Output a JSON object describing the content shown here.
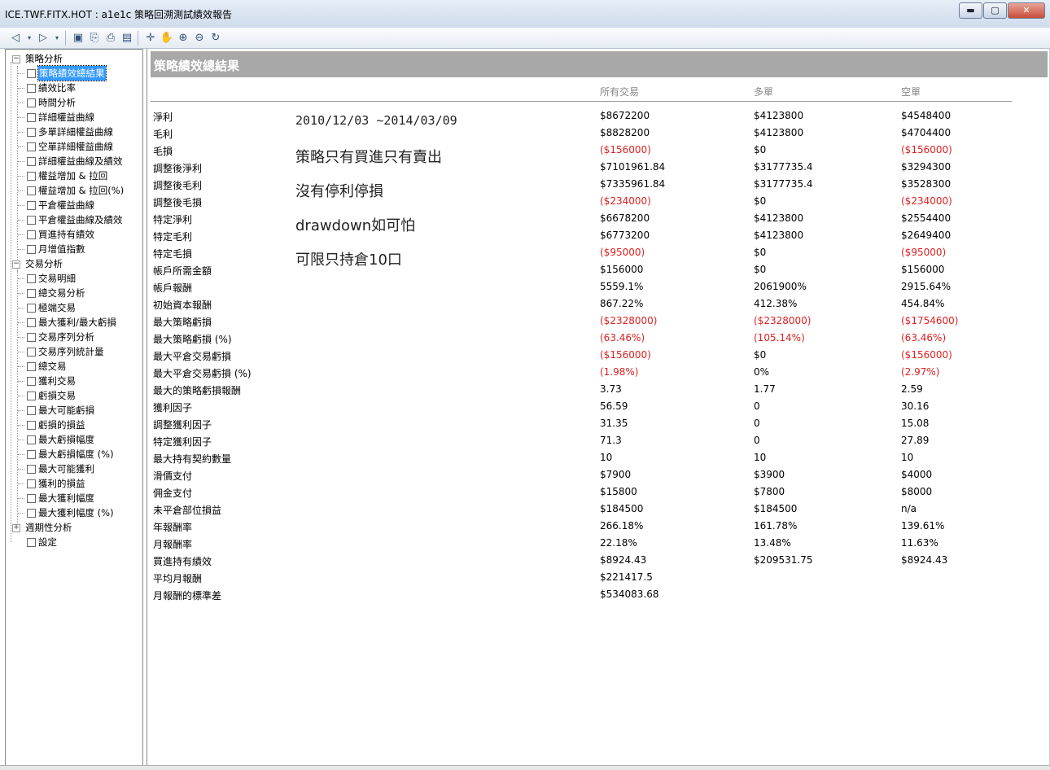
{
  "window": {
    "title": "ICE.TWF.FITX.HOT : a1e1c 策略回溯測試績效報告",
    "minimize": "▬",
    "maximize": "▢",
    "close": "✕"
  },
  "toolbar": {
    "back": "◁",
    "dropdown": "▾",
    "forward": "▷",
    "save": "▣",
    "export": "⎘",
    "print": "⎙",
    "view": "▤",
    "crosshair": "✛",
    "hand": "✋",
    "zoom_in": "⊕",
    "zoom_out": "⊖",
    "refresh": "↻"
  },
  "tree": {
    "strategy_analysis": "策略分析",
    "strategy_items": [
      "策略績效總結果",
      "績效比率",
      "時間分析",
      "詳細權益曲線",
      "多單詳細權益曲線",
      "空單詳細權益曲線",
      "詳細權益曲線及績效",
      "權益增加 & 拉回",
      "權益增加 & 拉回(%)",
      "平倉權益曲線",
      "平倉權益曲線及績效",
      "買進持有績效",
      "月增值指數"
    ],
    "trade_analysis": "交易分析",
    "trade_items": [
      "交易明細",
      "總交易分析",
      "極端交易",
      "最大獲利/最大虧損",
      "交易序列分析",
      "交易序列統計量",
      "總交易",
      "獲利交易",
      "虧損交易",
      "最大可能虧損",
      "虧損的損益",
      "最大虧損幅度",
      "最大虧損幅度 (%)",
      "最大可能獲利",
      "獲利的損益",
      "最大獲利幅度",
      "最大獲利幅度 (%)"
    ],
    "periodic_analysis": "週期性分析",
    "settings": "設定"
  },
  "report": {
    "title": "策略績效總結果",
    "columns": [
      "所有交易",
      "多單",
      "空單"
    ],
    "notes": [
      "2010/12/03 ~2014/03/09",
      "策略只有買進只有賣出",
      "沒有停利停損",
      "drawdown如可怕",
      "可限只持倉10口"
    ],
    "rows": [
      {
        "label": "淨利",
        "all": "$8672200",
        "long": "$4123800",
        "short": "$4548400"
      },
      {
        "label": "毛利",
        "all": "$8828200",
        "long": "$4123800",
        "short": "$4704400"
      },
      {
        "label": "毛損",
        "all": "($156000)",
        "long": "$0",
        "short": "($156000)"
      },
      {
        "label": "調整後淨利",
        "all": "$7101961.84",
        "long": "$3177735.4",
        "short": "$3294300"
      },
      {
        "label": "調整後毛利",
        "all": "$7335961.84",
        "long": "$3177735.4",
        "short": "$3528300"
      },
      {
        "label": "調整後毛損",
        "all": "($234000)",
        "long": "$0",
        "short": "($234000)"
      },
      {
        "label": "特定淨利",
        "all": "$6678200",
        "long": "$4123800",
        "short": "$2554400"
      },
      {
        "label": "特定毛利",
        "all": "$6773200",
        "long": "$4123800",
        "short": "$2649400"
      },
      {
        "label": "特定毛損",
        "all": "($95000)",
        "long": "$0",
        "short": "($95000)"
      },
      {
        "label": "帳戶所需金額",
        "all": "$156000",
        "long": "$0",
        "short": "$156000"
      },
      {
        "label": "帳戶報酬",
        "all": "5559.1%",
        "long": "2061900%",
        "short": "2915.64%"
      },
      {
        "label": "初始資本報酬",
        "all": "867.22%",
        "long": "412.38%",
        "short": "454.84%"
      },
      {
        "label": "最大策略虧損",
        "all": "($2328000)",
        "long": "($2328000)",
        "short": "($1754600)"
      },
      {
        "label": "最大策略虧損 (%)",
        "all": "(63.46%)",
        "long": "(105.14%)",
        "short": "(63.46%)"
      },
      {
        "label": "最大平倉交易虧損",
        "all": "($156000)",
        "long": "$0",
        "short": "($156000)"
      },
      {
        "label": "最大平倉交易虧損 (%)",
        "all": "(1.98%)",
        "long": "0%",
        "short": "(2.97%)"
      },
      {
        "label": "最大的策略虧損報酬",
        "all": "3.73",
        "long": "1.77",
        "short": "2.59"
      },
      {
        "label": "獲利因子",
        "all": "56.59",
        "long": "0",
        "short": "30.16"
      },
      {
        "label": "調整獲利因子",
        "all": "31.35",
        "long": "0",
        "short": "15.08"
      },
      {
        "label": "特定獲利因子",
        "all": "71.3",
        "long": "0",
        "short": "27.89"
      },
      {
        "label": "最大持有契約數量",
        "all": "10",
        "long": "10",
        "short": "10"
      },
      {
        "label": "滑價支付",
        "all": "$7900",
        "long": "$3900",
        "short": "$4000"
      },
      {
        "label": "佣金支付",
        "all": "$15800",
        "long": "$7800",
        "short": "$8000"
      },
      {
        "label": "未平倉部位損益",
        "all": "$184500",
        "long": "$184500",
        "short": "n/a"
      },
      {
        "label": "年報酬率",
        "all": "266.18%",
        "long": "161.78%",
        "short": "139.61%"
      },
      {
        "label": "月報酬率",
        "all": "22.18%",
        "long": "13.48%",
        "short": "11.63%"
      },
      {
        "label": "買進持有績效",
        "all": "$8924.43",
        "long": "$209531.75",
        "short": "$8924.43"
      },
      {
        "label": "平均月報酬",
        "all": "$221417.5",
        "long": "",
        "short": ""
      },
      {
        "label": "月報酬的標準差",
        "all": "$534083.68",
        "long": "",
        "short": ""
      }
    ]
  }
}
